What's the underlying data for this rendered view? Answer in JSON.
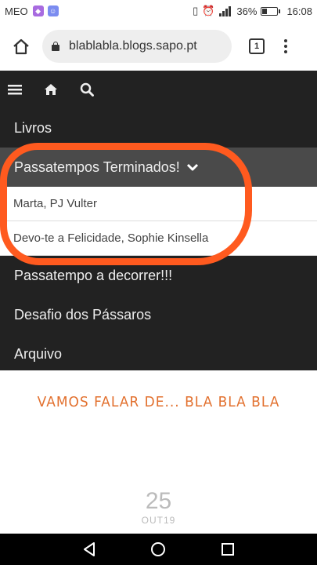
{
  "status_bar": {
    "carrier": "MEO",
    "battery_percent": "36%",
    "battery_level": 0.36,
    "time": "16:08"
  },
  "browser": {
    "url": "blablabla.blogs.sapo.pt",
    "tab_count": "1"
  },
  "site_nav": {
    "items": [
      {
        "label": "Livros"
      },
      {
        "label": "Passatempos Terminados!"
      },
      {
        "label": "Passatempo a decorrer!!!"
      },
      {
        "label": "Desafio dos Pássaros"
      },
      {
        "label": "Arquivo"
      }
    ],
    "submenu": [
      {
        "label": "Marta, PJ Vulter"
      },
      {
        "label": "Devo-te a Felicidade, Sophie Kinsella"
      }
    ]
  },
  "content": {
    "tagline": "VAMOS FALAR DE... BLA BLA BLA",
    "date_day": "25",
    "date_month": "OUT19"
  },
  "colors": {
    "nav_bg": "#222222",
    "nav_active_bg": "#4a4a4a",
    "highlight": "#ff5a1f",
    "tagline": "#e2702e"
  }
}
